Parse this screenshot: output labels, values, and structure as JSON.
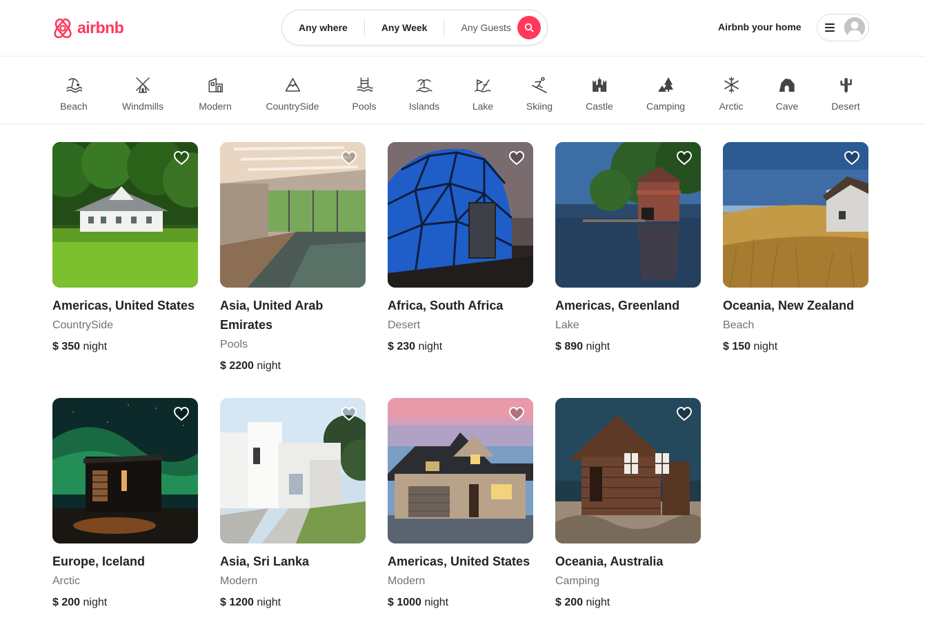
{
  "brand": {
    "name": "airbnb",
    "color": "#ff385c"
  },
  "search": {
    "where": "Any where",
    "week": "Any Week",
    "guests": "Any Guests"
  },
  "header": {
    "host_link": "Airbnb your home"
  },
  "categories": [
    {
      "label": "Beach",
      "icon": "beach-icon"
    },
    {
      "label": "Windmills",
      "icon": "windmill-icon"
    },
    {
      "label": "Modern",
      "icon": "modern-house-icon"
    },
    {
      "label": "CountrySide",
      "icon": "mountain-icon"
    },
    {
      "label": "Pools",
      "icon": "pool-icon"
    },
    {
      "label": "Islands",
      "icon": "island-icon"
    },
    {
      "label": "Lake",
      "icon": "lake-icon"
    },
    {
      "label": "Skiing",
      "icon": "skiing-icon"
    },
    {
      "label": "Castle",
      "icon": "castle-icon"
    },
    {
      "label": "Camping",
      "icon": "camping-icon"
    },
    {
      "label": "Arctic",
      "icon": "snowflake-icon"
    },
    {
      "label": "Cave",
      "icon": "cave-icon"
    },
    {
      "label": "Desert",
      "icon": "cactus-icon"
    }
  ],
  "listings": [
    {
      "title": "Americas, United States",
      "category": "CountrySide",
      "price": "$ 350",
      "unit": "night"
    },
    {
      "title": "Asia, United Arab Emirates",
      "category": "Pools",
      "price": "$ 2200",
      "unit": "night"
    },
    {
      "title": "Africa, South Africa",
      "category": "Desert",
      "price": "$ 230",
      "unit": "night"
    },
    {
      "title": "Americas, Greenland",
      "category": "Lake",
      "price": "$ 890",
      "unit": "night"
    },
    {
      "title": "Oceania, New Zealand",
      "category": "Beach",
      "price": "$ 150",
      "unit": "night"
    },
    {
      "title": "Europe, Iceland",
      "category": "Arctic",
      "price": "$ 200",
      "unit": "night"
    },
    {
      "title": "Asia, Sri Lanka",
      "category": "Modern",
      "price": "$ 1200",
      "unit": "night"
    },
    {
      "title": "Americas, United States",
      "category": "Modern",
      "price": "$ 1000",
      "unit": "night"
    },
    {
      "title": "Oceania, Australia",
      "category": "Camping",
      "price": "$ 200",
      "unit": "night"
    }
  ]
}
